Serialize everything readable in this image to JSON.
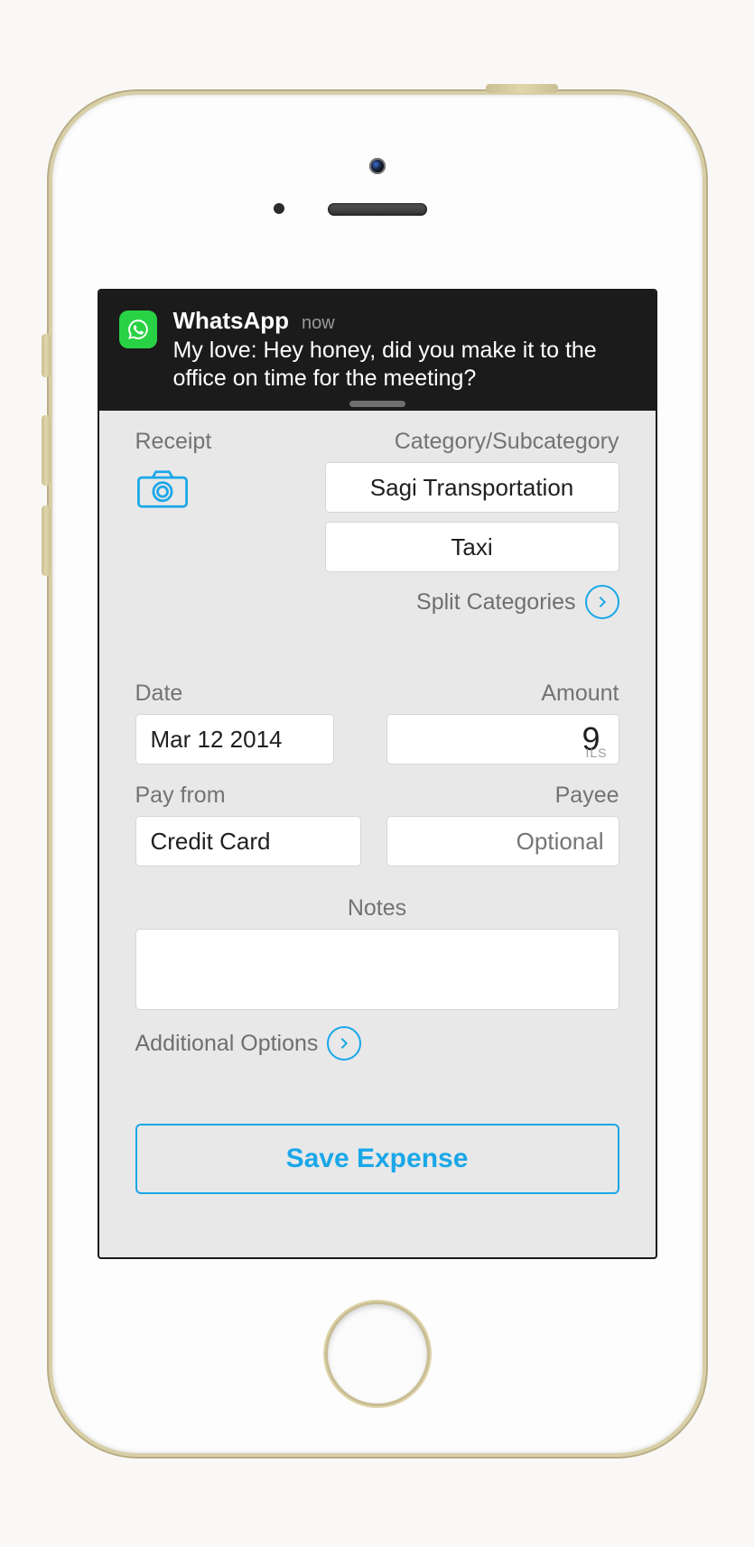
{
  "notification": {
    "app_name": "WhatsApp",
    "timestamp_label": "now",
    "message": "My love: Hey honey, did you make it to the office on time for the meeting?",
    "icon_name": "whatsapp-icon"
  },
  "form": {
    "receipt": {
      "label": "Receipt"
    },
    "category": {
      "label": "Category/Subcategory",
      "category_value": "Sagi Transportation",
      "subcategory_value": "Taxi",
      "split_link": "Split Categories"
    },
    "date": {
      "label": "Date",
      "value": "Mar 12 2014"
    },
    "amount": {
      "label": "Amount",
      "value": "9",
      "currency": "ILS"
    },
    "pay_from": {
      "label": "Pay from",
      "value": "Credit Card"
    },
    "payee": {
      "label": "Payee",
      "placeholder": "Optional",
      "value": ""
    },
    "notes": {
      "label": "Notes",
      "value": ""
    },
    "additional_options_link": "Additional Options",
    "save_button_label": "Save Expense"
  },
  "colors": {
    "accent": "#1aa7e8"
  }
}
